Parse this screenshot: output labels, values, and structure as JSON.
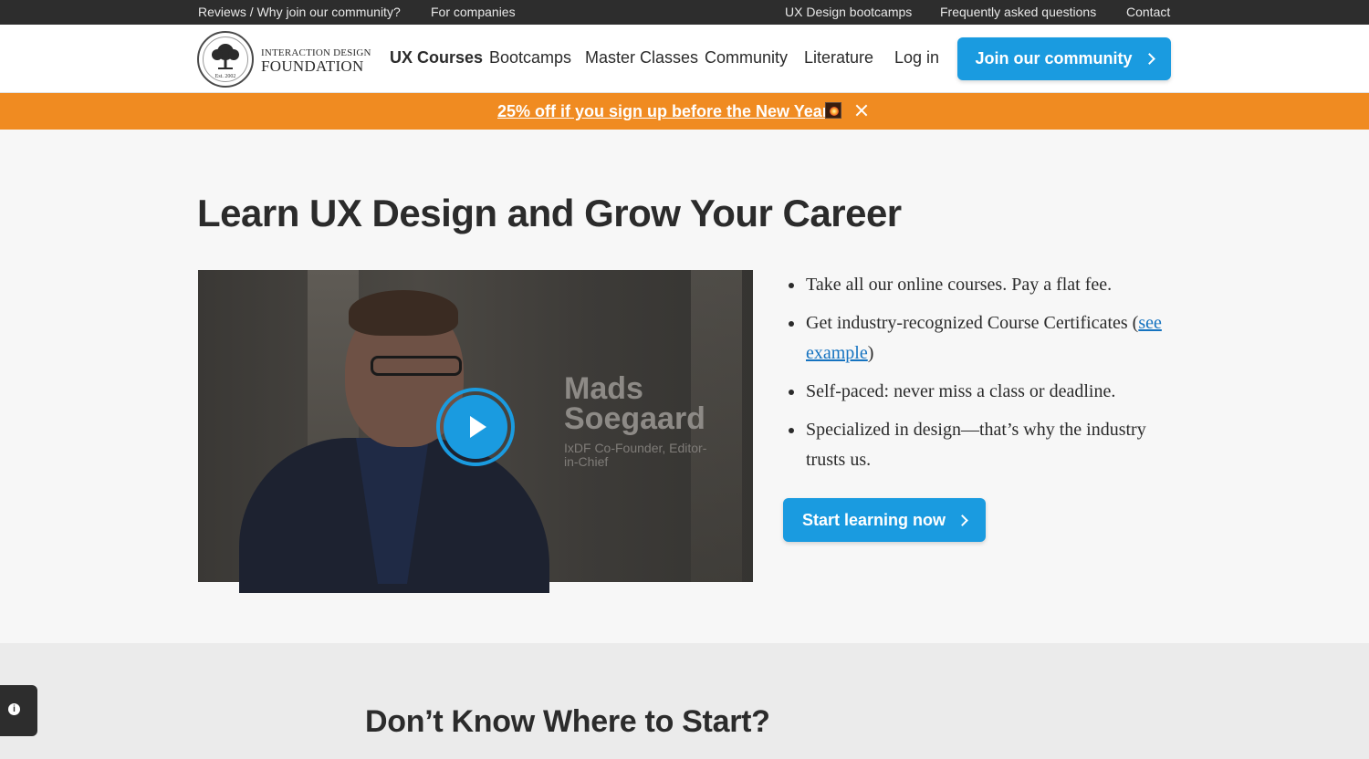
{
  "topbar": {
    "left_links": [
      "Reviews / Why join our community?",
      "For companies"
    ],
    "right_links": [
      "UX Design bootcamps",
      "Frequently asked questions",
      "Contact"
    ]
  },
  "header": {
    "brand_line1": "INTERACTION DESIGN",
    "brand_line2": "FOUNDATION",
    "logo_est": "Est. 2002",
    "nav": [
      "UX Courses",
      "Bootcamps",
      "Master Classes",
      "Community",
      "Literature"
    ],
    "login": "Log in",
    "join_button": "Join our community"
  },
  "promo": {
    "text": "25% off if you sign up before the New Year!",
    "icon": "firework-icon"
  },
  "hero": {
    "title": "Learn UX Design and Grow Your Career",
    "video": {
      "name": "Mads Soegaard",
      "role": "IxDF Co-Founder, Editor-in-Chief"
    },
    "bullets": [
      "Take all our online courses. Pay a flat fee.",
      "Get industry-recognized Course Certificates (",
      "Self-paced: never miss a class or deadline.",
      "Specialized in design—that’s why the industry trusts us."
    ],
    "bullet2_link": "see example",
    "bullet2_suffix": ")",
    "cta": "Start learning now"
  },
  "section2": {
    "title": "Don’t Know Where to Start?"
  },
  "colors": {
    "accent": "#1a9be0",
    "promo": "#f08b21",
    "topbar": "#2d2d2d"
  }
}
